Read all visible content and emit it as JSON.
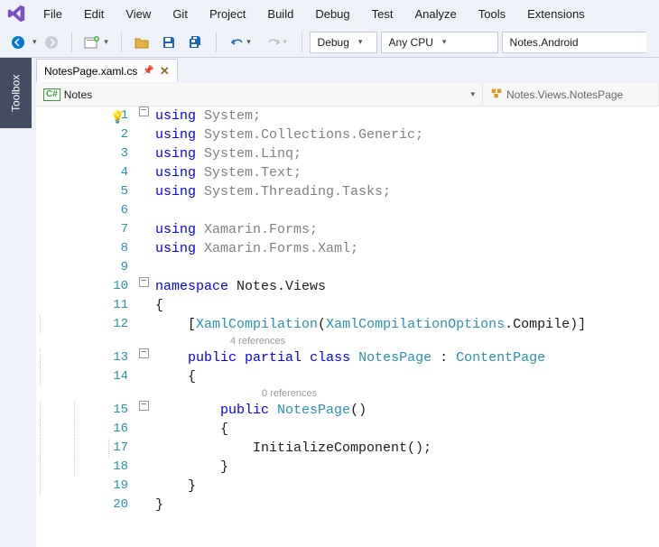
{
  "menubar": {
    "items": [
      "File",
      "Edit",
      "View",
      "Git",
      "Project",
      "Build",
      "Debug",
      "Test",
      "Analyze",
      "Tools",
      "Extensions"
    ]
  },
  "toolbar": {
    "configuration": "Debug",
    "platform": "Any CPU",
    "startup_project": "Notes.Android"
  },
  "sidebar": {
    "toolbox_label": "Toolbox"
  },
  "tab": {
    "filename": "NotesPage.xaml.cs"
  },
  "navbar": {
    "left": "Notes",
    "right": "Notes.Views.NotesPage"
  },
  "codelens": {
    "class_refs": "4 references",
    "ctor_refs": "0 references"
  },
  "code": {
    "l1a": "using",
    "l1b": " System;",
    "l2a": "using",
    "l2b": " System.Collections.Generic;",
    "l3a": "using",
    "l3b": " System.Linq;",
    "l4a": "using",
    "l4b": " System.Text;",
    "l5a": "using",
    "l5b": " System.Threading.Tasks;",
    "l7a": "using",
    "l7b": " Xamarin.Forms;",
    "l8a": "using",
    "l8b": " Xamarin.Forms.Xaml;",
    "l10a": "namespace",
    "l10b": " Notes.Views",
    "l11": "{",
    "l12a": "    [",
    "l12b": "XamlCompilation",
    "l12c": "(",
    "l12d": "XamlCompilationOptions",
    "l12e": ".Compile)]",
    "l13a": "    ",
    "l13b": "public",
    "l13c": " ",
    "l13d": "partial",
    "l13e": " ",
    "l13f": "class",
    "l13g": " ",
    "l13h": "NotesPage",
    "l13i": " : ",
    "l13j": "ContentPage",
    "l14": "    {",
    "l15a": "        ",
    "l15b": "public",
    "l15c": " ",
    "l15d": "NotesPage",
    "l15e": "()",
    "l16": "        {",
    "l17": "            InitializeComponent();",
    "l18": "        }",
    "l19": "    }",
    "l20": "}"
  },
  "line_numbers": [
    "1",
    "2",
    "3",
    "4",
    "5",
    "6",
    "7",
    "8",
    "9",
    "10",
    "11",
    "12",
    "13",
    "14",
    "15",
    "16",
    "17",
    "18",
    "19",
    "20"
  ]
}
